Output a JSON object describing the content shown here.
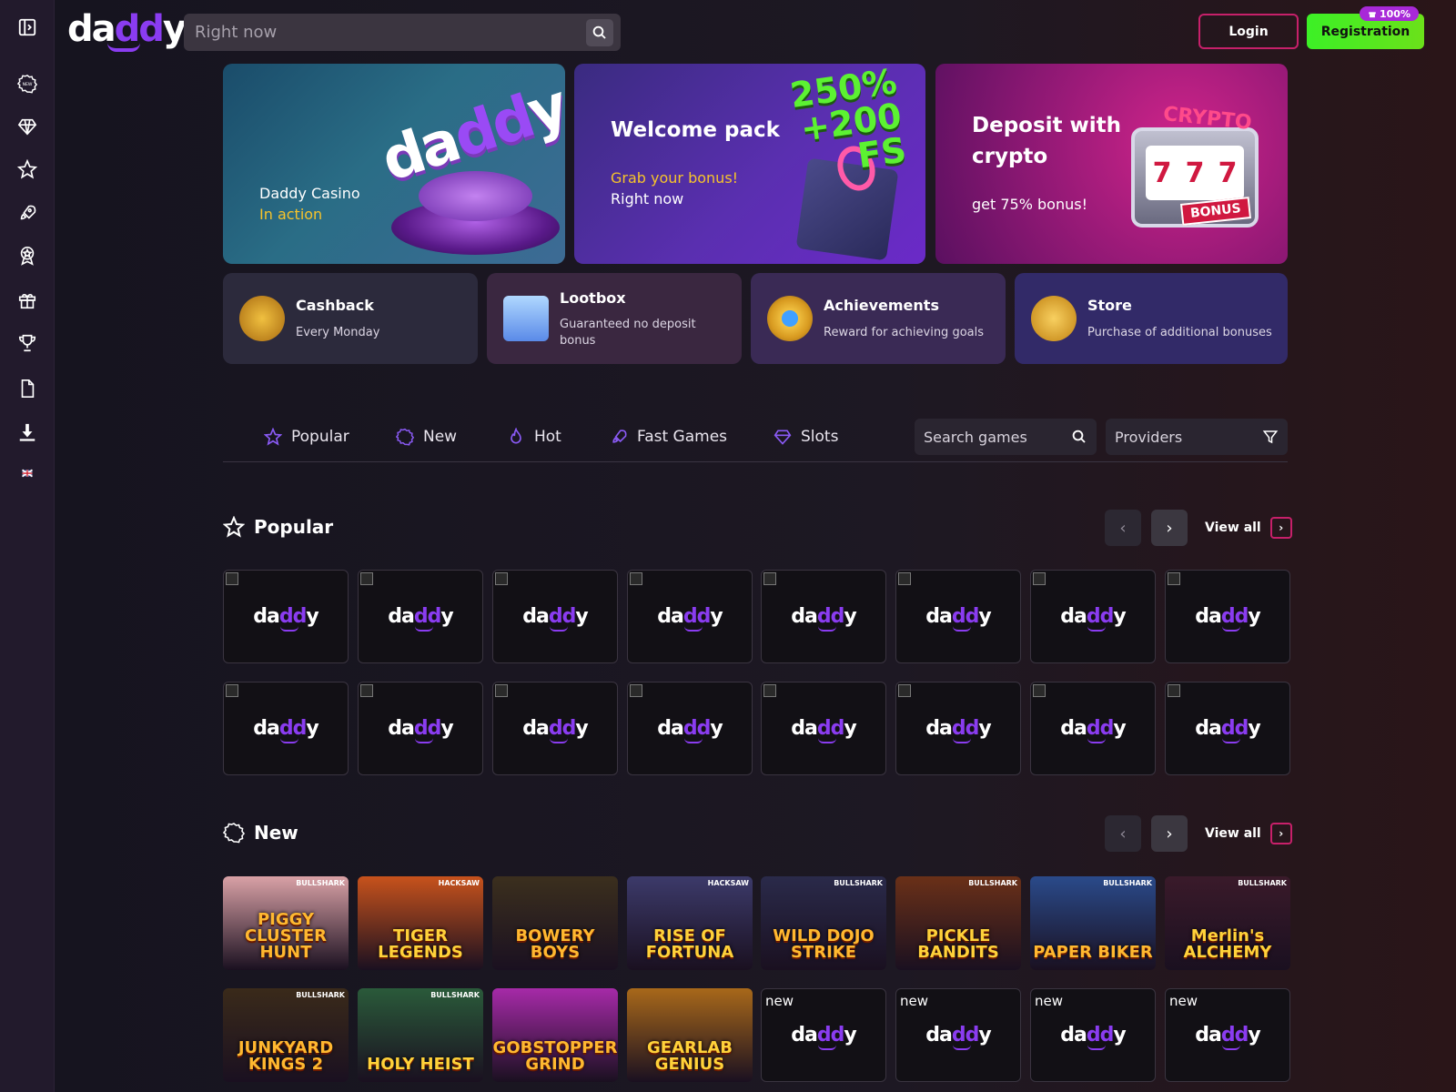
{
  "header": {
    "logo_text_a": "da",
    "logo_text_b": "dd",
    "logo_text_c": "y",
    "search_placeholder": "Right now",
    "login_label": "Login",
    "register_label": "Registration",
    "register_badge": "100%"
  },
  "sidebar": {
    "items": [
      {
        "icon": "sidebar-toggle-icon"
      },
      {
        "icon": "new-badge-icon"
      },
      {
        "icon": "diamond-icon"
      },
      {
        "icon": "star-icon"
      },
      {
        "icon": "rocket-icon"
      },
      {
        "icon": "medal-icon"
      },
      {
        "icon": "gift-icon"
      },
      {
        "icon": "trophy-icon"
      },
      {
        "icon": "document-icon"
      },
      {
        "icon": "download-icon"
      },
      {
        "icon": "uk-flag-icon"
      }
    ]
  },
  "banners": [
    {
      "logo": "daddy",
      "line1": "Daddy Casino",
      "line2": "In action"
    },
    {
      "headline": "250% +200 FS",
      "title": "Welcome pack",
      "line1": "Grab your bonus!",
      "line2": "Right now"
    },
    {
      "title_a": "Deposit with",
      "title_b": "crypto",
      "sub": "get 75% bonus!",
      "stamp_a": "CRYPTO",
      "stamp_b": "BONUS"
    }
  ],
  "promos": [
    {
      "title": "Cashback",
      "sub": "Every Monday"
    },
    {
      "title": "Lootbox",
      "sub": "Guaranteed no deposit bonus"
    },
    {
      "title": "Achievements",
      "sub": "Reward for achieving goals"
    },
    {
      "title": "Store",
      "sub": "Purchase of additional bonuses"
    }
  ],
  "tabs": [
    {
      "label": "Popular",
      "icon": "star-icon"
    },
    {
      "label": "New",
      "icon": "new-badge-icon"
    },
    {
      "label": "Hot",
      "icon": "flame-icon"
    },
    {
      "label": "Fast Games",
      "icon": "rocket-icon"
    },
    {
      "label": "Slots",
      "icon": "diamond-icon"
    }
  ],
  "game_search_placeholder": "Search games",
  "providers_label": "Providers",
  "sections": {
    "popular": {
      "title": "Popular",
      "view_all": "View all"
    },
    "new": {
      "title": "New",
      "view_all": "View all"
    }
  },
  "new_games": [
    {
      "name": "PIGGY CLUSTER HUNT",
      "provider": "BULLSHARK",
      "color": "#d9a1a6"
    },
    {
      "name": "TIGER LEGENDS",
      "provider": "HACKSAW",
      "color": "#c7521c"
    },
    {
      "name": "BOWERY BOYS",
      "provider": "",
      "color": "#3b2f1e"
    },
    {
      "name": "RISE OF FORTUNA",
      "provider": "HACKSAW",
      "color": "#3c3a6a"
    },
    {
      "name": "WILD DOJO STRIKE",
      "provider": "BULLSHARK",
      "color": "#2a2a4a"
    },
    {
      "name": "PICKLE BANDITS",
      "provider": "BULLSHARK",
      "color": "#6a3018"
    },
    {
      "name": "PAPER BIKER",
      "provider": "BULLSHARK",
      "color": "#2a4a8a"
    },
    {
      "name": "Merlin's ALCHEMY",
      "provider": "BULLSHARK",
      "color": "#3a1a2a"
    },
    {
      "name": "JUNKYARD KINGS 2",
      "provider": "BULLSHARK",
      "color": "#3a2a1a"
    },
    {
      "name": "HOLY HEIST",
      "provider": "BULLSHARK",
      "color": "#2a5a3a"
    },
    {
      "name": "GOBSTOPPER GRIND",
      "provider": "",
      "color": "#a62aa8"
    },
    {
      "name": "GEARLAB GENIUS",
      "provider": "",
      "color": "#a8681a"
    }
  ],
  "broken_alt": "new"
}
